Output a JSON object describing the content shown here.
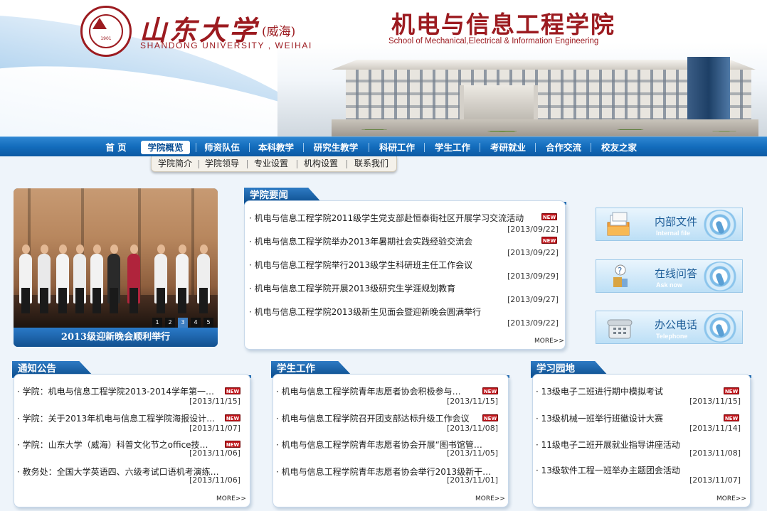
{
  "header": {
    "uni_name_cn": "山东大学",
    "uni_campus": "(威海)",
    "uni_name_en": "SHANDONG UNIVERSITY , WEIHAI",
    "seal_year": "1901",
    "school_cn": "机电与信息工程学院",
    "school_en": "School of Mechanical,Electrical & Information Engineering"
  },
  "nav": {
    "items": [
      {
        "label": "首 页"
      },
      {
        "label": "学院概览"
      },
      {
        "label": "师资队伍"
      },
      {
        "label": "本科教学"
      },
      {
        "label": "研究生教学"
      },
      {
        "label": "科研工作"
      },
      {
        "label": "学生工作"
      },
      {
        "label": "考研就业"
      },
      {
        "label": "合作交流"
      },
      {
        "label": "校友之家"
      }
    ],
    "active": "学院概览"
  },
  "subnav": {
    "items": [
      {
        "label": "学院简介"
      },
      {
        "label": "学院领导"
      },
      {
        "label": "专业设置"
      },
      {
        "label": "机构设置"
      },
      {
        "label": "联系我们"
      }
    ]
  },
  "slideshow": {
    "caption": "2013级迎新晚会顺利举行",
    "pages": [
      "1",
      "2",
      "3",
      "4",
      "5"
    ],
    "active_page": "3"
  },
  "news": {
    "title": "学院要闻",
    "more": "MORE>>",
    "items": [
      {
        "text": "· 机电与信息工程学院2011级学生党支部赴恒泰街社区开展学习交流活动",
        "date": "[2013/09/22]",
        "new": true
      },
      {
        "text": "· 机电与信息工程学院举办2013年暑期社会实践经验交流会",
        "date": "[2013/09/22]",
        "new": true
      },
      {
        "text": "· 机电与信息工程学院举行2013级学生科研班主任工作会议",
        "date": "[2013/09/29]",
        "new": false
      },
      {
        "text": "· 机电与信息工程学院开展2013级研究生学涯规划教育",
        "date": "[2013/09/27]",
        "new": false
      },
      {
        "text": "· 机电与信息工程学院2013级新生见面会暨迎新晚会圆满举行",
        "date": "[2013/09/22]",
        "new": false
      }
    ]
  },
  "quick_links": [
    {
      "label": "内部文件",
      "sub": "Internal file",
      "icon": "folder-icon"
    },
    {
      "label": "在线问答",
      "sub": "Ask now",
      "icon": "question-icon"
    },
    {
      "label": "办公电话",
      "sub": "Telephone",
      "icon": "telephone-icon"
    }
  ],
  "badge_text": "NEW",
  "notices": {
    "title": "通知公告",
    "more": "MORE>>",
    "items": [
      {
        "text": "· 学院：机电与信息工程学院2013-2014学年第一…",
        "date": "[2013/11/15]",
        "new": true
      },
      {
        "text": "· 学院：关于2013年机电与信息工程学院海报设计…",
        "date": "[2013/11/07]",
        "new": true
      },
      {
        "text": "· 学院：山东大学（威海）科普文化节之office技…",
        "date": "[2013/11/06]",
        "new": true
      },
      {
        "text": "· 教务处：全国大学英语四、六级考试口语机考演练…",
        "date": "[2013/11/06]",
        "new": false
      }
    ]
  },
  "student_work": {
    "title": "学生工作",
    "more": "MORE>>",
    "items": [
      {
        "text": "· 机电与信息工程学院青年志愿者协会积极参与…",
        "date": "[2013/11/15]",
        "new": true
      },
      {
        "text": "· 机电与信息工程学院召开团支部达标升级工作会议",
        "date": "[2013/11/08]",
        "new": true
      },
      {
        "text": "· 机电与信息工程学院青年志愿者协会开展“图书馆管…",
        "date": "[2013/11/05]",
        "new": false
      },
      {
        "text": "· 机电与信息工程学院青年志愿者协会举行2013级新干…",
        "date": "[2013/11/01]",
        "new": false
      }
    ]
  },
  "study": {
    "title": "学习园地",
    "more": "MORE>>",
    "items": [
      {
        "text": "· 13级电子二班进行期中模拟考试",
        "date": "[2013/11/15]",
        "new": true
      },
      {
        "text": "· 13级机械一班举行班徽设计大赛",
        "date": "[2013/11/14]",
        "new": true
      },
      {
        "text": "· 11级电子二班开展就业指导讲座活动",
        "date": "[2013/11/08]",
        "new": false
      },
      {
        "text": "· 13级软件工程一班举办主题团会活动",
        "date": "[2013/11/07]",
        "new": false
      }
    ]
  },
  "colors": {
    "brand_red": "#9c1b20",
    "nav_blue": "#136cbc",
    "new_badge": "#c0141a"
  }
}
